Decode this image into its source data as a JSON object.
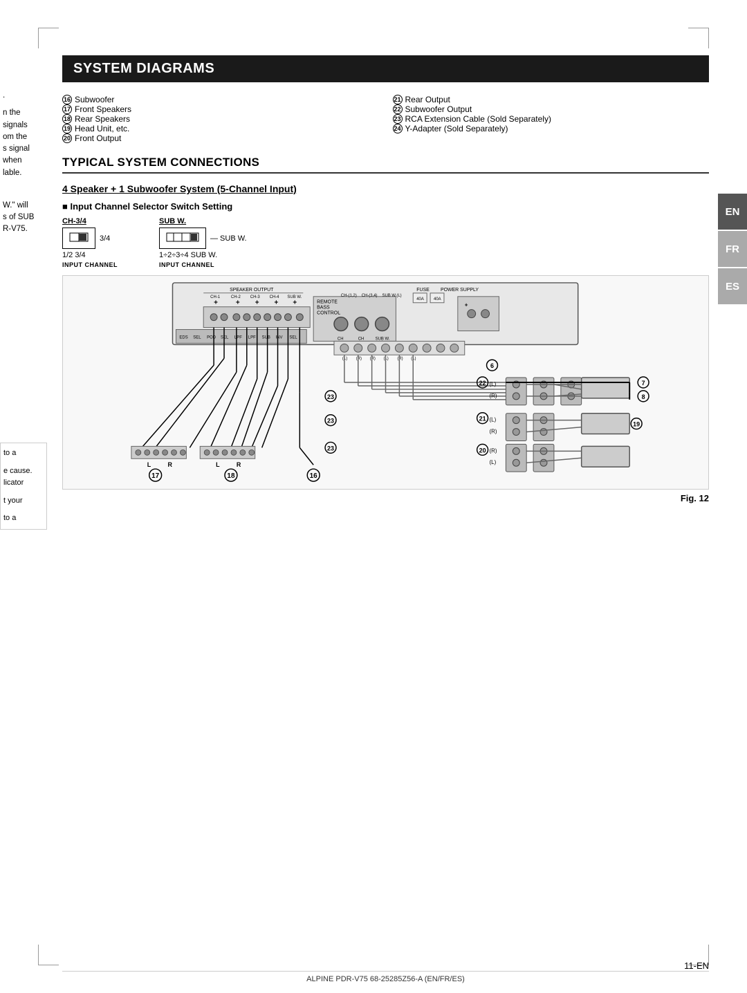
{
  "page": {
    "title": "SYSTEM DIAGRAMS",
    "subsection": "TYPICAL SYSTEM CONNECTIONS",
    "diagram_title": "4 Speaker + 1 Subwoofer System (5-Channel Input)",
    "input_selector_title": "Input Channel Selector Switch Setting",
    "fig_label": "Fig. 12",
    "page_number": "11",
    "page_suffix": "-EN",
    "footer_text": "ALPINE PDR-V75 68-25285Z56-A (EN/FR/ES)"
  },
  "legend": {
    "left": [
      {
        "num": "16",
        "text": "Subwoofer"
      },
      {
        "num": "17",
        "text": "Front Speakers"
      },
      {
        "num": "18",
        "text": "Rear Speakers"
      },
      {
        "num": "19",
        "text": "Head Unit, etc."
      },
      {
        "num": "20",
        "text": "Front Output"
      }
    ],
    "right": [
      {
        "num": "21",
        "text": "Rear Output"
      },
      {
        "num": "22",
        "text": "Subwoofer Output"
      },
      {
        "num": "23",
        "text": "RCA Extension Cable (Sold Separately)"
      },
      {
        "num": "24",
        "text": "Y-Adapter (Sold Separately)"
      }
    ]
  },
  "switches": {
    "ch34": {
      "label": "CH-3/4",
      "setting": "3/4",
      "range": "1/2   3/4",
      "caption": "INPUT CHANNEL"
    },
    "subw": {
      "label": "SUB W.",
      "setting": "SUB W.",
      "range": "1÷2÷3÷4  SUB W.",
      "caption": "INPUT CHANNEL"
    }
  },
  "lang_tabs": [
    {
      "code": "EN",
      "active": true
    },
    {
      "code": "FR",
      "active": false
    },
    {
      "code": "ES",
      "active": false
    }
  ],
  "left_edge_text": [
    ".",
    "n the",
    "signals",
    "om the",
    "s signal",
    "when",
    "lable.",
    "",
    "W.' will",
    "s of SUB",
    "R-V75."
  ]
}
